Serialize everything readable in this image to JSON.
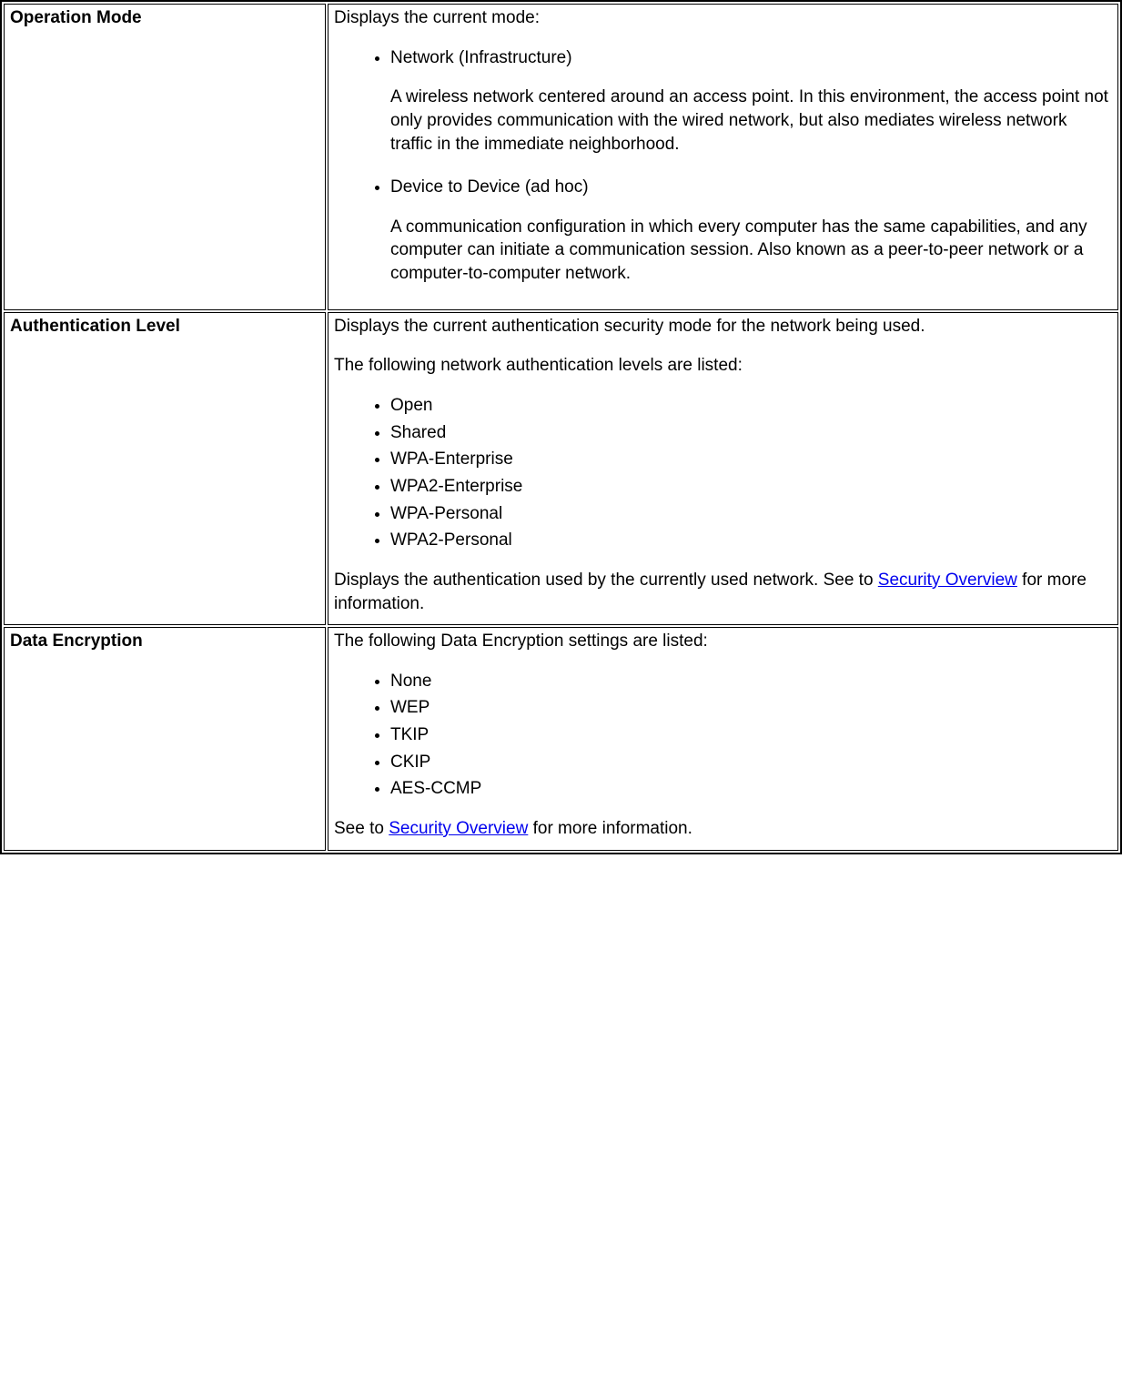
{
  "rows": [
    {
      "label": "Operation Mode",
      "intro": "Displays the current mode:",
      "modes": [
        {
          "title": "Network (Infrastructure)",
          "desc": "A wireless network centered around an access point. In this environment, the access point not only provides communication with the wired network, but also mediates wireless network traffic in the immediate neighborhood."
        },
        {
          "title": "Device to Device (ad hoc)",
          "desc": "A communication configuration in which every computer has the same capabilities, and any computer can initiate a communication session. Also known as a peer-to-peer network or a computer-to-computer network."
        }
      ]
    },
    {
      "label": "Authentication Level",
      "intro1": "Displays the current authentication security mode for the network being used.",
      "intro2": "The following network authentication levels are listed:",
      "items": [
        "Open",
        "Shared",
        "WPA-Enterprise",
        "WPA2-Enterprise",
        "WPA-Personal",
        "WPA2-Personal"
      ],
      "outro_pre": "Displays the authentication used by the currently used network. See to ",
      "link_text": "Security Overview",
      "outro_post": " for more information."
    },
    {
      "label": "Data Encryption",
      "intro": "The following Data Encryption settings are listed:",
      "items": [
        "None",
        "WEP",
        "TKIP",
        "CKIP",
        "AES-CCMP"
      ],
      "outro_pre": "See to ",
      "link_text": "Security Overview",
      "outro_post": " for more information."
    }
  ]
}
